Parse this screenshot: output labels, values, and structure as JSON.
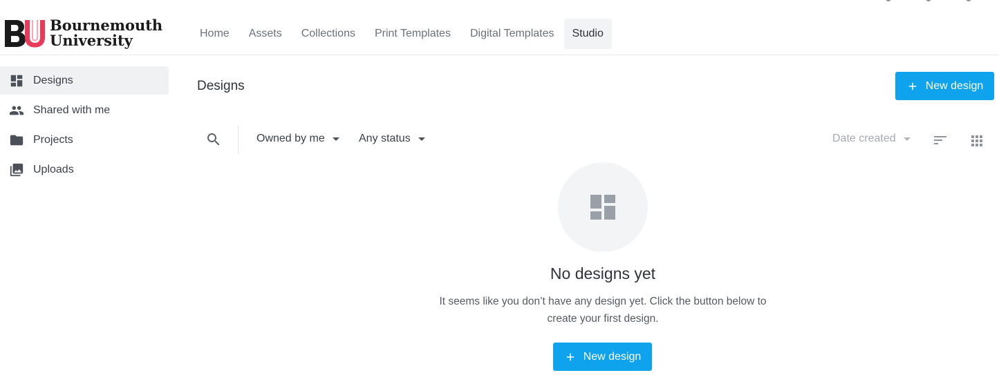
{
  "brand": {
    "logo_text_line1": "Bournemouth",
    "logo_text_line2": "University",
    "logo_colors": {
      "dark": "#1b1b1b",
      "accent": "#e83a5a"
    }
  },
  "nav": {
    "items": [
      {
        "label": "Home",
        "active": false
      },
      {
        "label": "Assets",
        "active": false
      },
      {
        "label": "Collections",
        "active": false
      },
      {
        "label": "Print Templates",
        "active": false
      },
      {
        "label": "Digital Templates",
        "active": false
      },
      {
        "label": "Studio",
        "active": true
      }
    ]
  },
  "sidebar": {
    "items": [
      {
        "label": "Designs",
        "icon": "dashboard-icon",
        "active": true
      },
      {
        "label": "Shared with me",
        "icon": "people-icon",
        "active": false
      },
      {
        "label": "Projects",
        "icon": "folder-icon",
        "active": false
      },
      {
        "label": "Uploads",
        "icon": "photo-library-icon",
        "active": false
      }
    ]
  },
  "main": {
    "title": "Designs",
    "new_design_label": "New design"
  },
  "toolbar": {
    "owner_filter": "Owned by me",
    "status_filter": "Any status",
    "sort_by": "Date created",
    "icons": [
      "search-icon",
      "sort-icon",
      "grid-view-icon"
    ]
  },
  "empty_state": {
    "icon": "dashboard-icon",
    "title": "No designs yet",
    "description": "It seems like you don’t have any design yet. Click the button below to create your first design.",
    "button_label": "New design"
  },
  "colors": {
    "primary": "#0fa3ee",
    "active_bg": "#f0f1f3",
    "text": "#3a3f47",
    "muted": "#a6aab0"
  }
}
